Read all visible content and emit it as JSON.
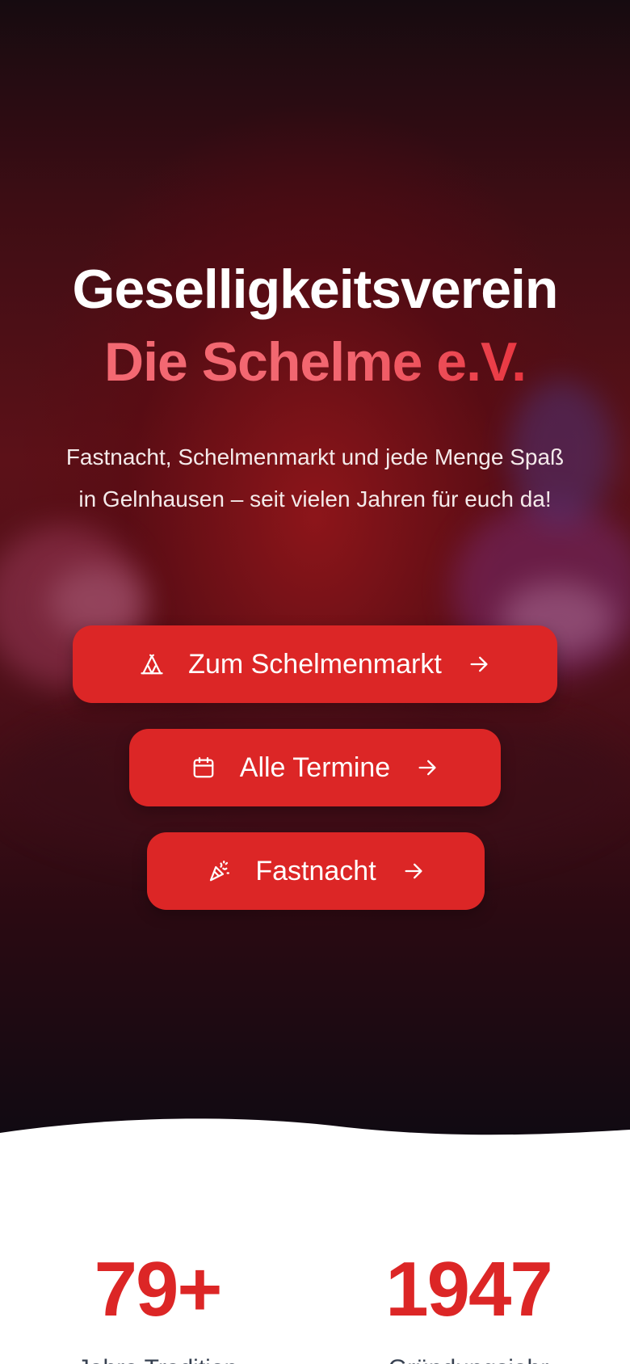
{
  "hero": {
    "title_line1": "Geselligkeitsverein",
    "title_line2": "Die Schelme e.V.",
    "subtitle": "Fastnacht, Schelmenmarkt und jede Menge Spaß in Gelnhausen – seit vielen Jahren für euch da!",
    "buttons": [
      {
        "label": "Zum Schelmenmarkt",
        "icon": "tent-icon"
      },
      {
        "label": "Alle Termine",
        "icon": "calendar-icon"
      },
      {
        "label": "Fastnacht",
        "icon": "party-popper-icon"
      }
    ]
  },
  "stats": [
    {
      "value": "79+",
      "label": "Jahre Tradition"
    },
    {
      "value": "1947",
      "label": "Gründungsjahr"
    }
  ],
  "colors": {
    "accent": "#dc2626",
    "title_gradient_start": "#f46a73",
    "title_gradient_end": "#e02a35",
    "hero_dark": "#160b10",
    "stat_label": "#374151"
  }
}
